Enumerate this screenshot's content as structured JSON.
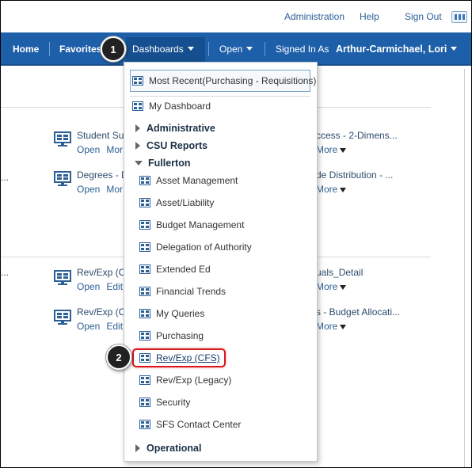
{
  "top_links": {
    "administration": "Administration",
    "help": "Help",
    "sign_out": "Sign Out"
  },
  "navbar": {
    "home": "Home",
    "favorites": "Favorites",
    "dashboards": "Dashboards",
    "open": "Open",
    "signed_in_as": "Signed In As",
    "user": "Arthur-Carmichael, Lori"
  },
  "badges": {
    "step1": "1",
    "step2": "2"
  },
  "background_items": [
    {
      "title": "Student Su",
      "actions": [
        "Open",
        "Mor"
      ]
    },
    {
      "title": "Degrees - D",
      "actions": [
        "Open",
        "Mor"
      ]
    },
    {
      "title": "ccess - 2-Dimens...",
      "actions": [],
      "more": "More"
    },
    {
      "title": "de Distribution - ...",
      "actions": [],
      "more": "More"
    },
    {
      "title": "Rev/Exp (C",
      "actions": [
        "Open",
        "Edit"
      ]
    },
    {
      "title": "Rev/Exp (C",
      "actions": [
        "Open",
        "Edit"
      ]
    },
    {
      "title": "uals_Detail",
      "actions": [],
      "more": "More"
    },
    {
      "title": "s - Budget Allocati...",
      "actions": [],
      "more": "More"
    },
    {
      "title": "..."
    }
  ],
  "dropdown": {
    "most_recent": "Most Recent(Purchasing - Requisitions)",
    "my_dashboard": "My Dashboard",
    "groups": {
      "administrative": "Administrative",
      "csu_reports": "CSU Reports",
      "fullerton": "Fullerton",
      "operational": "Operational"
    },
    "fullerton_items": [
      "Asset Management",
      "Asset/Liability",
      "Budget Management",
      "Delegation of Authority",
      "Extended Ed",
      "Financial Trends",
      "My Queries",
      "Purchasing",
      "Rev/Exp (CFS)",
      "Rev/Exp (Legacy)",
      "Security",
      "SFS Contact Center"
    ]
  },
  "colors": {
    "navbar": "#1d5fa9",
    "link": "#2c5f96",
    "highlight_border": "#d9161c"
  },
  "icons": {
    "dashboard": "dashboard-grid-icon",
    "monitor": "monitor-grid-icon",
    "apps": "apps-grid-icon"
  }
}
